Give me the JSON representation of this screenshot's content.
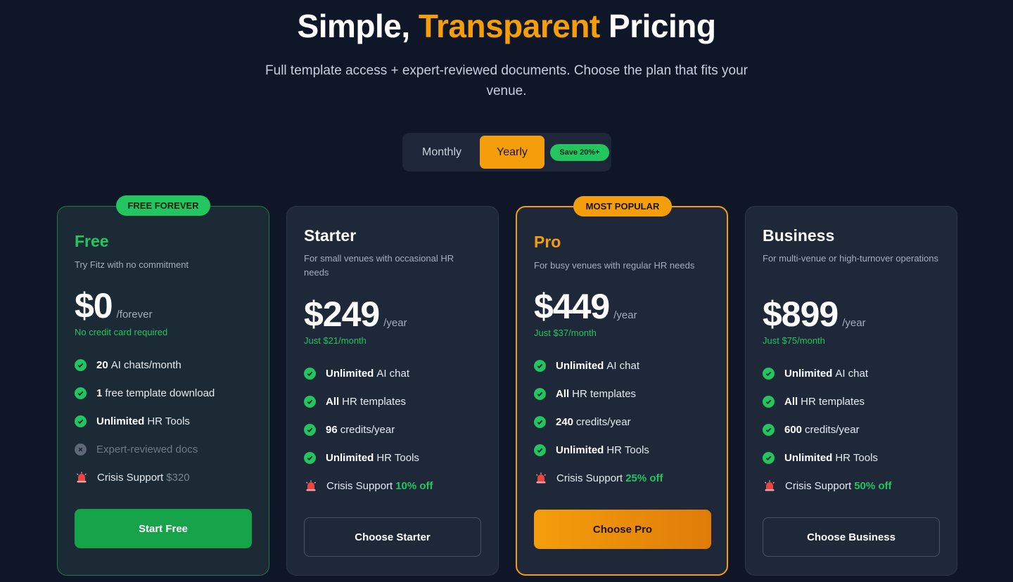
{
  "header": {
    "title_part1": "Simple,",
    "title_accent": "Transparent",
    "title_part2": "Pricing",
    "subtitle": "Full template access + expert-reviewed documents. Choose the plan that fits your venue."
  },
  "billing_toggle": {
    "monthly_label": "Monthly",
    "yearly_label": "Yearly",
    "selected": "Yearly",
    "save_badge": "Save 20%+"
  },
  "colors": {
    "background": "#0e1627",
    "accent_orange": "#f59e0b",
    "accent_green": "#22c55e",
    "card_bg": "#1e2839"
  },
  "plans": [
    {
      "ribbon": "FREE FOREVER",
      "name": "Free",
      "name_color": "#22c55e",
      "description": "Try Fitz with no commitment",
      "price": "$0",
      "period": "/forever",
      "price_note": "No credit card required",
      "features": [
        {
          "icon": "check-icon",
          "bold": "20",
          "text": "AI chats/month"
        },
        {
          "icon": "check-icon",
          "bold": "1",
          "text": "free template download"
        },
        {
          "icon": "check-icon",
          "bold": "Unlimited",
          "text": "HR Tools"
        },
        {
          "icon": "cross-icon",
          "bold": "",
          "text": "Expert-reviewed docs"
        },
        {
          "icon": "siren-icon",
          "bold": "",
          "text": "Crisis Support",
          "extra": "$320"
        }
      ],
      "cta": "Start Free"
    },
    {
      "name": "Starter",
      "name_color": "#ffffff",
      "description": "For small venues with occasional HR needs",
      "price": "$249",
      "period": "/year",
      "price_note": "Just $21/month",
      "features": [
        {
          "icon": "check-icon",
          "bold": "Unlimited",
          "text": "AI chat"
        },
        {
          "icon": "check-icon",
          "bold": "All",
          "text": "HR templates"
        },
        {
          "icon": "check-icon",
          "bold": "96",
          "text": "credits/year"
        },
        {
          "icon": "check-icon",
          "bold": "Unlimited",
          "text": "HR Tools"
        },
        {
          "icon": "siren-icon",
          "bold": "",
          "text": "Crisis Support",
          "extra": "10% off"
        }
      ],
      "cta": "Choose Starter"
    },
    {
      "ribbon": "MOST POPULAR",
      "name": "Pro",
      "name_color": "#f59e0b",
      "description": "For busy venues with regular HR needs",
      "price": "$449",
      "period": "/year",
      "price_note": "Just $37/month",
      "features": [
        {
          "icon": "check-icon",
          "bold": "Unlimited",
          "text": "AI chat"
        },
        {
          "icon": "check-icon",
          "bold": "All",
          "text": "HR templates"
        },
        {
          "icon": "check-icon",
          "bold": "240",
          "text": "credits/year"
        },
        {
          "icon": "check-icon",
          "bold": "Unlimited",
          "text": "HR Tools"
        },
        {
          "icon": "siren-icon",
          "bold": "",
          "text": "Crisis Support",
          "extra": "25% off"
        }
      ],
      "cta": "Choose Pro"
    },
    {
      "name": "Business",
      "name_color": "#ffffff",
      "description": "For multi-venue or high-turnover operations",
      "price": "$899",
      "period": "/year",
      "price_note": "Just $75/month",
      "features": [
        {
          "icon": "check-icon",
          "bold": "Unlimited",
          "text": "AI chat"
        },
        {
          "icon": "check-icon",
          "bold": "All",
          "text": "HR templates"
        },
        {
          "icon": "check-icon",
          "bold": "600",
          "text": "credits/year"
        },
        {
          "icon": "check-icon",
          "bold": "Unlimited",
          "text": "HR Tools"
        },
        {
          "icon": "siren-icon",
          "bold": "",
          "text": "Crisis Support",
          "extra": "50% off"
        }
      ],
      "cta": "Choose Business"
    }
  ]
}
